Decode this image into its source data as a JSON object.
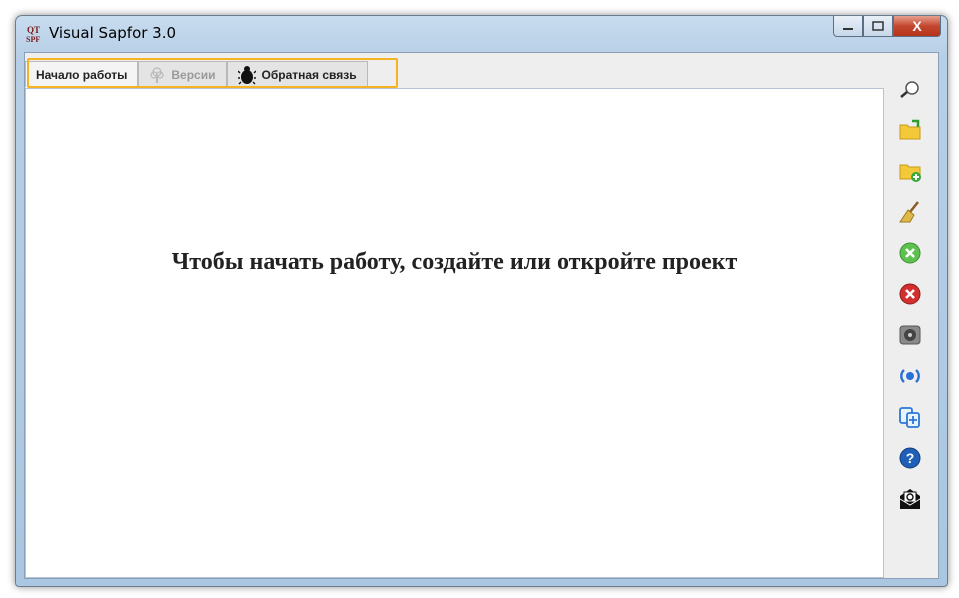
{
  "window": {
    "title": "Visual Sapfor 3.0",
    "app_icon_text": "SPF",
    "controls": {
      "minimize": "–",
      "maximize": "□",
      "close": "X"
    }
  },
  "tabs": [
    {
      "label": "Начало работы",
      "state": "active",
      "icon": ""
    },
    {
      "label": "Версии",
      "state": "disabled",
      "icon": "tree-icon"
    },
    {
      "label": "Обратная связь",
      "state": "normal",
      "icon": "bug-icon"
    }
  ],
  "main": {
    "message": "Чтобы начать работу, создайте или откройте проект"
  },
  "toolbar": {
    "items": [
      {
        "icon": "search-icon"
      },
      {
        "icon": "open-folder-icon"
      },
      {
        "icon": "new-folder-icon"
      },
      {
        "icon": "broom-icon"
      },
      {
        "icon": "green-close-icon"
      },
      {
        "icon": "red-close-icon"
      },
      {
        "icon": "drive-icon"
      },
      {
        "icon": "broadcast-icon"
      },
      {
        "icon": "add-file-icon"
      },
      {
        "icon": "help-icon"
      },
      {
        "icon": "mail-icon"
      }
    ]
  },
  "colors": {
    "tab_highlight": "#f4b322",
    "close_button": "#c4472f",
    "title_bar": "#c8dcef"
  }
}
